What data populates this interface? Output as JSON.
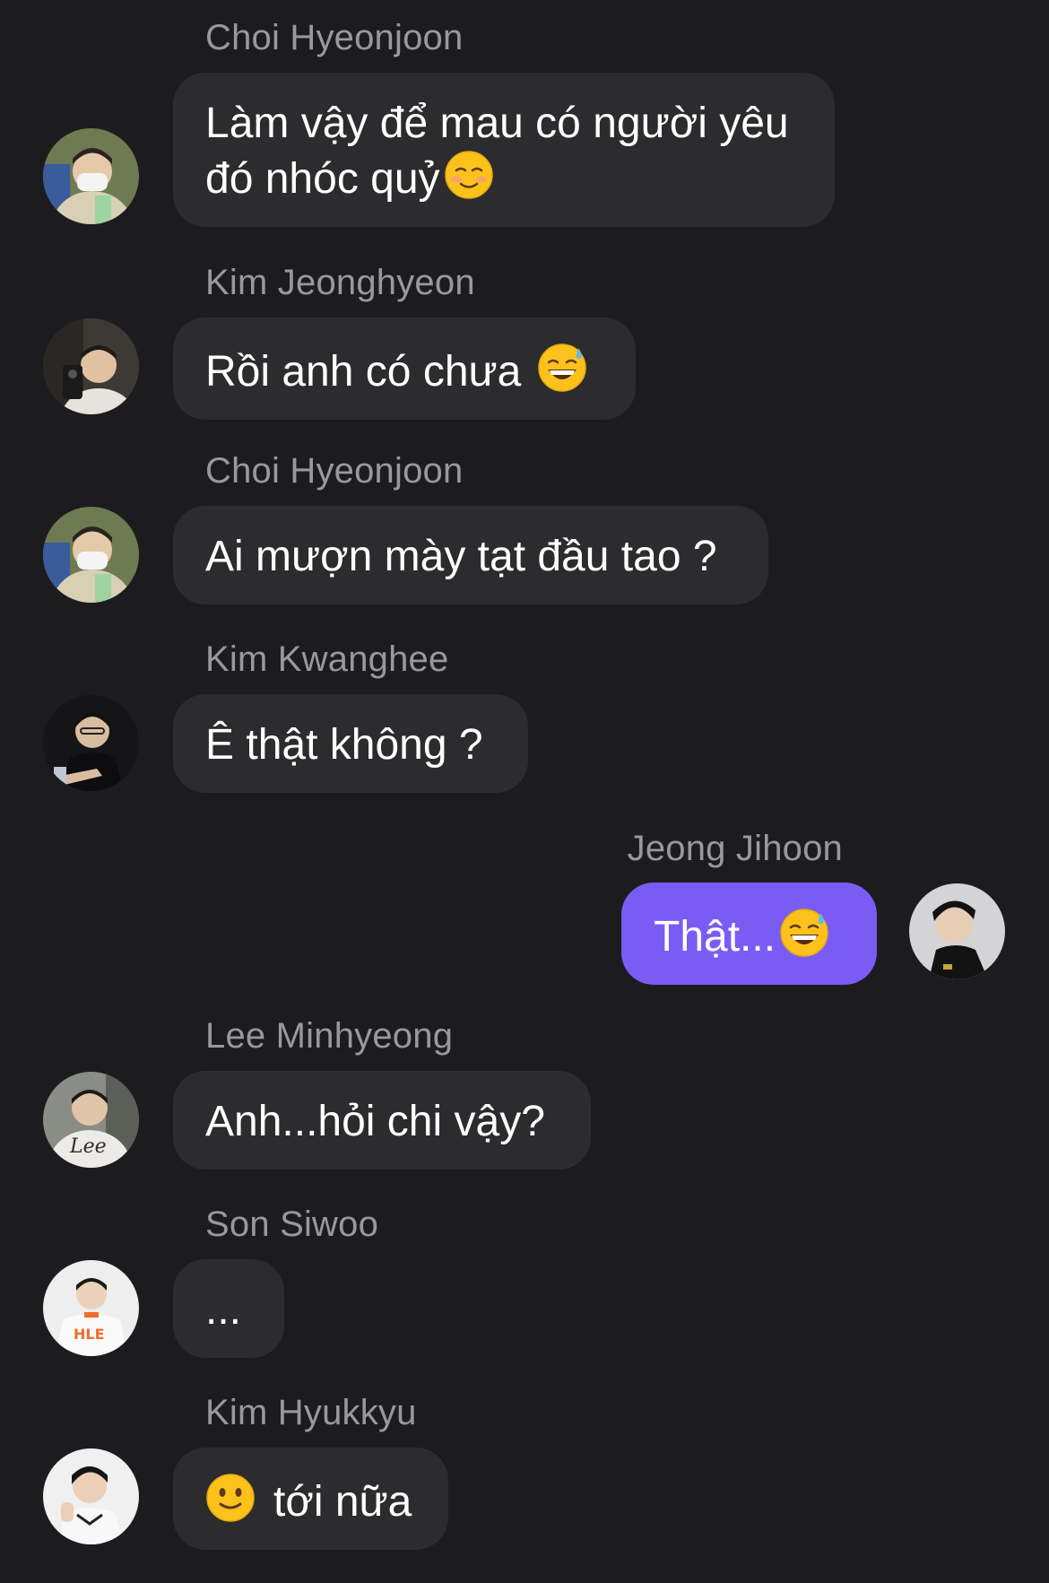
{
  "messages": [
    {
      "sender": "Choi Hyeonjoon",
      "text": "Làm vậy để mau có người yêu đó nhóc quỷ",
      "emoji": "smiling-blush-emoji",
      "direction": "incoming"
    },
    {
      "sender": "Kim Jeonghyeon",
      "text": "Rồi anh có chưa ",
      "emoji": "grinning-sweat-emoji",
      "direction": "incoming"
    },
    {
      "sender": "Choi Hyeonjoon",
      "text": "Ai mượn mày tạt đầu tao ?",
      "direction": "incoming"
    },
    {
      "sender": "Kim Kwanghee",
      "text": "Ê thật không ?",
      "direction": "incoming"
    },
    {
      "sender": "Jeong Jihoon",
      "text": "Thật...",
      "emoji": "grinning-sweat-emoji",
      "direction": "outgoing"
    },
    {
      "sender": "Lee Minhyeong",
      "text": "Anh...hỏi chi vậy?",
      "direction": "incoming"
    },
    {
      "sender": "Son Siwoo",
      "text": "...",
      "direction": "incoming"
    },
    {
      "sender": "Kim Hyukkyu",
      "text": "tới nữa",
      "emoji": "slightly-smiling-emoji",
      "direction": "incoming"
    }
  ],
  "colors": {
    "background": "#1c1c1e",
    "incoming_bubble": "#2c2c2e",
    "outgoing_bubble": "#7a5cf5",
    "sender_name": "#98989d",
    "message_text": "#ffffff"
  }
}
